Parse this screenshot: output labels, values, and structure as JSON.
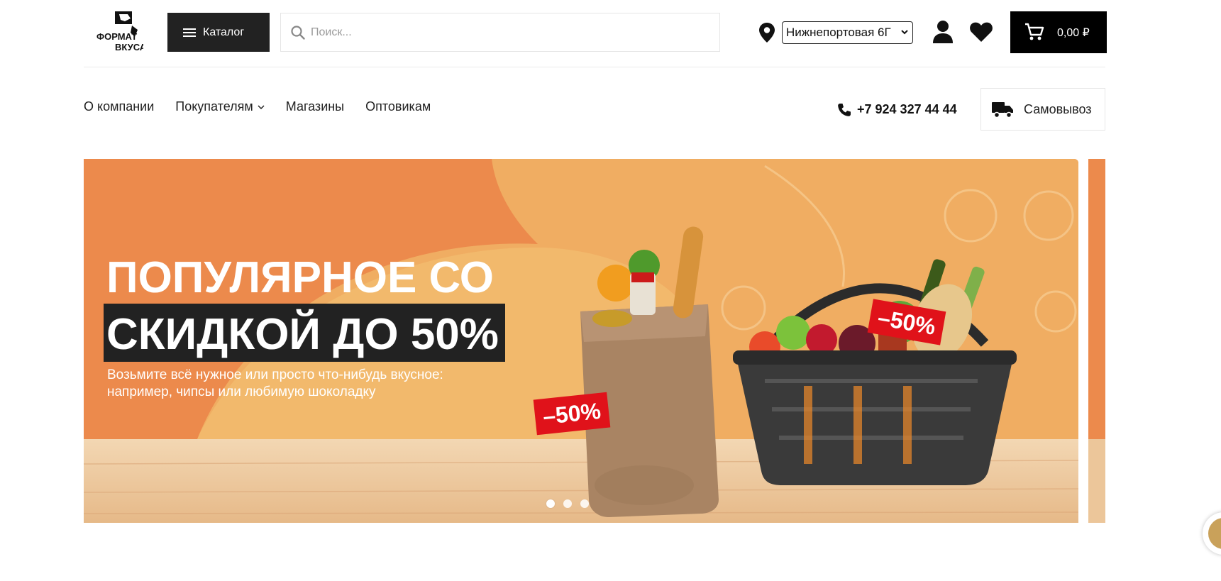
{
  "header": {
    "logo_text_top": "ФОРМАТ",
    "logo_text_bottom": "ВКУСА",
    "catalog_label": "Каталог",
    "search_placeholder": "Поиск...",
    "store_selected": "Нижнепортовая 6Г",
    "cart_sum": "0,00 ₽"
  },
  "nav": {
    "items": [
      {
        "label": "О компании"
      },
      {
        "label": "Покупателям"
      },
      {
        "label": "Магазины"
      },
      {
        "label": "Оптовикам"
      }
    ],
    "phone": "+7 924 327 44 44",
    "pickup_label": "Самовывоз"
  },
  "banner": {
    "line1": "ПОПУЛЯРНОЕ СО",
    "line2": "СКИДКОЙ ДО 50%",
    "subtitle_line1": "Возьмите всё нужное или просто что-нибудь вкусное:",
    "subtitle_line2": "например, чипсы или любимую шоколадку",
    "tag1": "–50%",
    "tag2": "–50%",
    "slides_total": 3,
    "active_slide": 1
  },
  "colors": {
    "brand_dark": "#222222",
    "banner_orange": "#ef8f4f",
    "banner_light": "#f2b466",
    "discount_red": "#e0121a"
  },
  "icons": [
    "menu-icon",
    "search-icon",
    "location-pin-icon",
    "chevron-down-icon",
    "user-icon",
    "heart-icon",
    "cart-icon",
    "phone-icon",
    "truck-icon",
    "chat-icon"
  ]
}
